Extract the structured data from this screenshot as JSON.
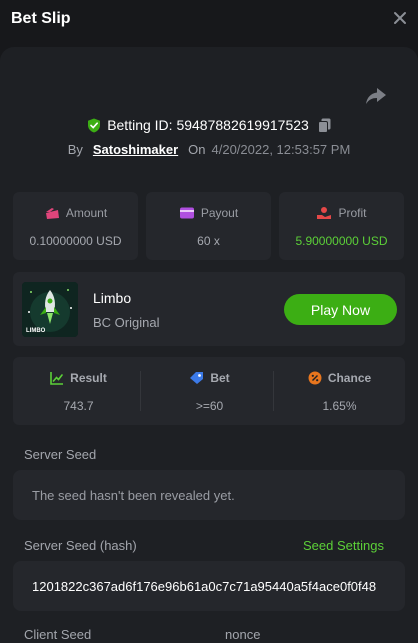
{
  "header": {
    "title": "Bet Slip"
  },
  "bet": {
    "id_text": "Betting ID: 59487882619917523",
    "by_label": "By",
    "user": "Satoshimaker",
    "on_label": "On",
    "date": "4/20/2022, 12:53:57 PM"
  },
  "stats": {
    "amount": {
      "label": "Amount",
      "value": "0.10000000 USD"
    },
    "payout": {
      "label": "Payout",
      "value": "60 x"
    },
    "profit": {
      "label": "Profit",
      "value": "5.90000000 USD"
    }
  },
  "game": {
    "name": "Limbo",
    "subtitle": "BC Original",
    "play_label": "Play Now",
    "thumb_label": "LIMBO"
  },
  "results": {
    "result": {
      "label": "Result",
      "value": "743.7"
    },
    "bet": {
      "label": "Bet",
      "value": ">=60"
    },
    "chance": {
      "label": "Chance",
      "value": "1.65%"
    }
  },
  "seeds": {
    "server_seed_label": "Server Seed",
    "server_seed_value": "The seed hasn't been revealed yet.",
    "server_hash_label": "Server Seed (hash)",
    "seed_settings_label": "Seed Settings",
    "server_hash_value": "1201822c367ad6f176e96b61a0c7c71a95440a5f4ace0f0f48",
    "client_seed_label": "Client Seed",
    "nonce_label": "nonce"
  },
  "colors": {
    "background": "#17181b",
    "panel": "#1e2024",
    "card": "#25272c",
    "accent_green": "#3cae14",
    "profit_green": "#5cd038"
  }
}
